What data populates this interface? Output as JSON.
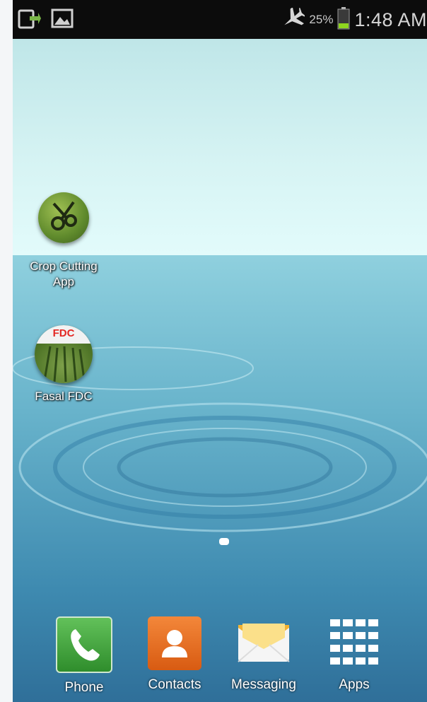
{
  "status_bar": {
    "left_icons": [
      "screen-rotate-icon",
      "image-icon"
    ],
    "airplane_icon": "airplane-icon",
    "battery_percent": "25%",
    "battery_level": 0.25,
    "time": "1:48 AM"
  },
  "home_shortcuts": [
    {
      "label_line1": "Crop Cutting",
      "label_line2": "App",
      "icon": "crop-cutting-app-icon"
    },
    {
      "label_line1": "Fasal FDC",
      "icon": "fasal-fdc-icon",
      "badge_text": "FDC"
    }
  ],
  "dock": [
    {
      "label": "Phone",
      "icon": "phone-icon"
    },
    {
      "label": "Contacts",
      "icon": "contacts-icon"
    },
    {
      "label": "Messaging",
      "icon": "messaging-icon"
    },
    {
      "label": "Apps",
      "icon": "apps-grid-icon"
    }
  ],
  "colors": {
    "status_bar_bg": "#0c0c0c",
    "battery_fill": "#8ed51f",
    "sky": "#d7f4f4",
    "water": "#68b3cb"
  }
}
